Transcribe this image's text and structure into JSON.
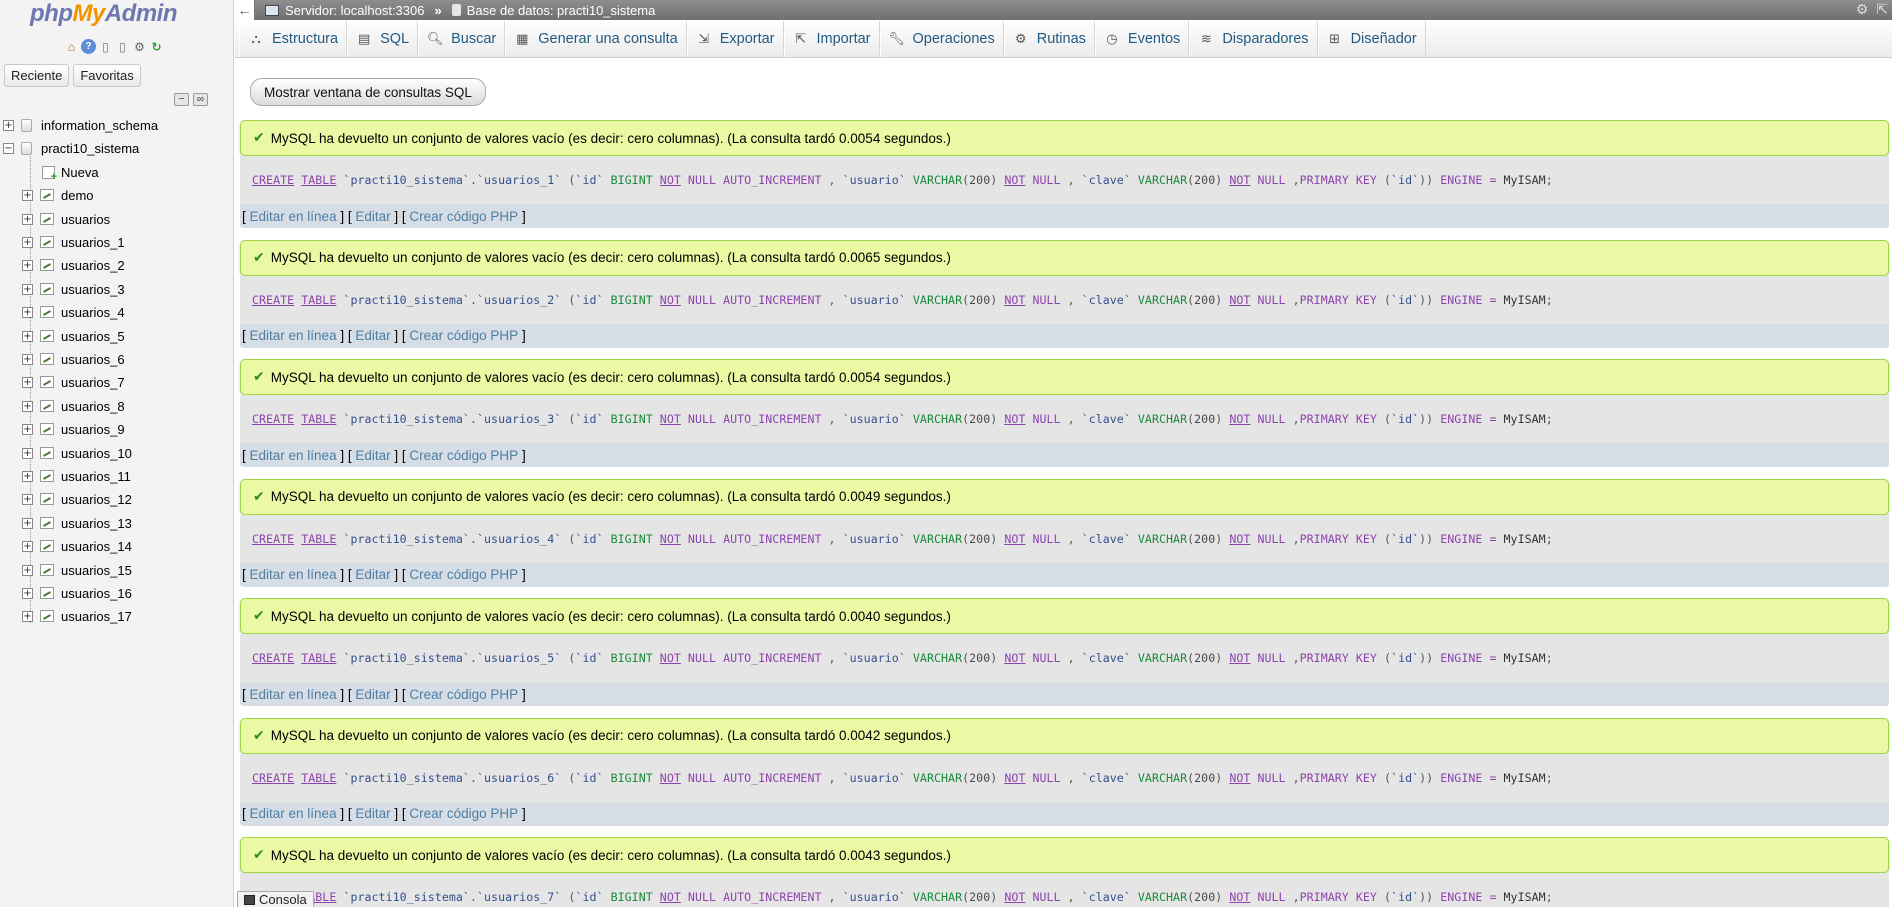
{
  "logo": {
    "php": "php",
    "my": "My",
    "admin": "Admin"
  },
  "nav": {
    "tabs": [
      "Reciente",
      "Favoritas"
    ],
    "databases": [
      {
        "name": "information_schema",
        "expanded": false
      },
      {
        "name": "practi10_sistema",
        "expanded": true
      }
    ],
    "new_label": "Nueva",
    "tables": [
      "demo",
      "usuarios",
      "usuarios_1",
      "usuarios_2",
      "usuarios_3",
      "usuarios_4",
      "usuarios_5",
      "usuarios_6",
      "usuarios_7",
      "usuarios_8",
      "usuarios_9",
      "usuarios_10",
      "usuarios_11",
      "usuarios_12",
      "usuarios_13",
      "usuarios_14",
      "usuarios_15",
      "usuarios_16",
      "usuarios_17"
    ]
  },
  "topbar": {
    "server": "Servidor: localhost:3306",
    "separator": "»",
    "database": "Base de datos: practi10_sistema"
  },
  "menu": [
    {
      "label": "Estructura",
      "icon": "structure-icon"
    },
    {
      "label": "SQL",
      "icon": "sql-icon"
    },
    {
      "label": "Buscar",
      "icon": "search-icon"
    },
    {
      "label": "Generar una consulta",
      "icon": "query-icon"
    },
    {
      "label": "Exportar",
      "icon": "export-icon"
    },
    {
      "label": "Importar",
      "icon": "import-icon"
    },
    {
      "label": "Operaciones",
      "icon": "wrench-icon"
    },
    {
      "label": "Rutinas",
      "icon": "routines-icon"
    },
    {
      "label": "Eventos",
      "icon": "clock-icon"
    },
    {
      "label": "Disparadores",
      "icon": "trigger-icon"
    },
    {
      "label": "Diseñador",
      "icon": "designer-icon"
    }
  ],
  "show_sql_button": "Mostrar ventana de consultas SQL",
  "results": [
    {
      "message": "MySQL ha devuelto un conjunto de valores vacío (es decir: cero columnas). (La consulta tardó 0.0054 segundos.)",
      "table": "usuarios_1"
    },
    {
      "message": "MySQL ha devuelto un conjunto de valores vacío (es decir: cero columnas). (La consulta tardó 0.0065 segundos.)",
      "table": "usuarios_2"
    },
    {
      "message": "MySQL ha devuelto un conjunto de valores vacío (es decir: cero columnas). (La consulta tardó 0.0054 segundos.)",
      "table": "usuarios_3"
    },
    {
      "message": "MySQL ha devuelto un conjunto de valores vacío (es decir: cero columnas). (La consulta tardó 0.0049 segundos.)",
      "table": "usuarios_4"
    },
    {
      "message": "MySQL ha devuelto un conjunto de valores vacío (es decir: cero columnas). (La consulta tardó 0.0040 segundos.)",
      "table": "usuarios_5"
    },
    {
      "message": "MySQL ha devuelto un conjunto de valores vacío (es decir: cero columnas). (La consulta tardó 0.0042 segundos.)",
      "table": "usuarios_6"
    },
    {
      "message": "MySQL ha devuelto un conjunto de valores vacío (es decir: cero columnas). (La consulta tardó 0.0043 segundos.)",
      "table": "usuarios_7"
    }
  ],
  "sql": {
    "db": "practi10_sistema",
    "col_id": "id",
    "col_usuario": "usuario",
    "col_clave": "clave",
    "varchar_len": "200",
    "engine": "MyISAM"
  },
  "actions": {
    "edit_inline": "Editar en línea",
    "edit": "Editar",
    "create_php": "Crear código PHP"
  },
  "console_label": "Consola"
}
